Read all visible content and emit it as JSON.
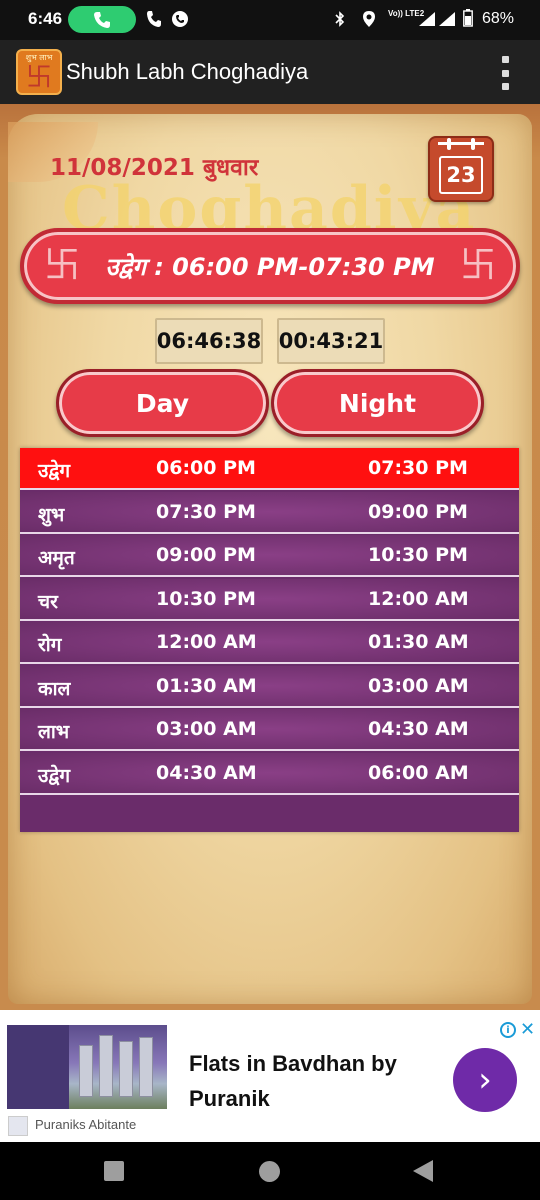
{
  "status_bar": {
    "time": "6:46",
    "battery": "68%",
    "network_label": "Vo)) LTE2"
  },
  "app": {
    "title": "Shubh Labh Choghadiya",
    "logo_text": "शुभ लाभ",
    "logo_symbol": "卐"
  },
  "header": {
    "date": "11/08/2021 बुधवार",
    "watermark": "Choghadiya",
    "calendar_day": "23"
  },
  "current": {
    "banner": "उद्वेग : 06:00 PM-07:30 PM",
    "swastika": "卐"
  },
  "clocks": {
    "current_time": "06:46:38",
    "remaining": "00:43:21"
  },
  "toggle": {
    "day": "Day",
    "night": "Night",
    "selected": "Night"
  },
  "table": {
    "rows": [
      {
        "name": "उद्वेग",
        "start": "06:00 PM",
        "end": "07:30 PM",
        "active": true
      },
      {
        "name": "शुभ",
        "start": "07:30 PM",
        "end": "09:00 PM",
        "active": false
      },
      {
        "name": "अमृत",
        "start": "09:00 PM",
        "end": "10:30 PM",
        "active": false
      },
      {
        "name": "चर",
        "start": "10:30 PM",
        "end": "12:00 AM",
        "active": false
      },
      {
        "name": "रोग",
        "start": "12:00 AM",
        "end": "01:30 AM",
        "active": false
      },
      {
        "name": "काल",
        "start": "01:30 AM",
        "end": "03:00 AM",
        "active": false
      },
      {
        "name": "लाभ",
        "start": "03:00 AM",
        "end": "04:30 AM",
        "active": false
      },
      {
        "name": "उद्वेग",
        "start": "04:30 AM",
        "end": "06:00 AM",
        "active": false
      }
    ]
  },
  "ad": {
    "title_line1": "Flats in Bavdhan by",
    "title_line2": "Puranik",
    "sponsor": "Puraniks Abitante",
    "info": "i",
    "close": "✕",
    "arrow": "›"
  },
  "colors": {
    "active_row": "#ff1010",
    "table_row": "#6a2d68",
    "banner": "#e73b48",
    "app_bar": "#212121",
    "date_text": "#d0343a"
  }
}
